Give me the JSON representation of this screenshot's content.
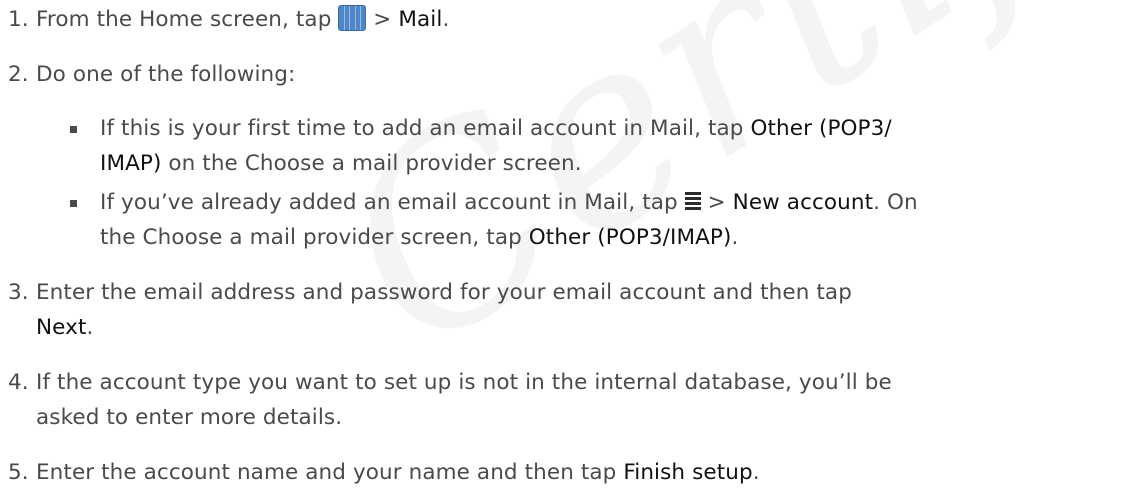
{
  "watermark": "Certificatio",
  "steps": [
    {
      "num": "1.",
      "pre": "From the Home screen, tap ",
      "icon": "apps-grid-icon",
      "mid": " > ",
      "bold": "Mail",
      "post": "."
    },
    {
      "num": "2.",
      "text": "Do one of the following:"
    },
    {
      "num": "3.",
      "line1": "Enter the email address and password for your email account and then tap",
      "bold": "Next",
      "post": "."
    },
    {
      "num": "4.",
      "line1": "If the account type you want to set up is not in the internal database, you’ll be",
      "line2": "asked to enter more details."
    },
    {
      "num": "5.",
      "pre": "Enter the account name and your name and then tap ",
      "bold": "Finish setup",
      "post": "."
    }
  ],
  "sub_items": [
    {
      "pre": "If this is your first time to add an email account in Mail, tap ",
      "bold1": "Other (POP3/",
      "bold2": "IMAP)",
      "post": " on the Choose a mail provider screen."
    },
    {
      "pre": "If you’ve already added an email account in Mail, tap ",
      "icon": "menu-icon",
      "mid": " > ",
      "bold1": "New account",
      "post1": ". On",
      "line2_pre": "the Choose a mail provider screen, tap ",
      "bold2": "Other (POP3/IMAP)",
      "post2": "."
    }
  ]
}
